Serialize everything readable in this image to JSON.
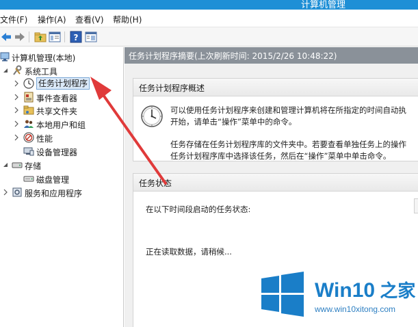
{
  "window": {
    "title": "计算机管理"
  },
  "menu": {
    "items": [
      {
        "label": "文件(F)"
      },
      {
        "label": "操作(A)"
      },
      {
        "label": "查看(V)"
      },
      {
        "label": "帮助(H)"
      }
    ]
  },
  "toolbar": {
    "buttons": [
      "back-arrow-icon",
      "forward-arrow-icon",
      "up-folder-icon",
      "show-hide-tree-icon",
      "help-icon",
      "properties-icon"
    ]
  },
  "tree": {
    "root": "计算机管理(本地)",
    "system_tools": "系统工具",
    "task_scheduler": "任务计划程序",
    "event_viewer": "事件查看器",
    "shared_folders": "共享文件夹",
    "local_users": "本地用户和组",
    "performance": "性能",
    "device_manager": "设备管理器",
    "storage": "存储",
    "disk_management": "磁盘管理",
    "services_apps": "服务和应用程序"
  },
  "pane": {
    "header": "任务计划程序摘要(上次刷新时间: 2015/2/26 10:48:22)",
    "overview": {
      "title": "任务计划程序概述",
      "line1": "可以使用任务计划程序来创建和管理计算机将在所指定的时间自动执",
      "line2": "开始，请单击“操作”菜单中的命令。",
      "line3": "任务存储在任务计划程序库的文件夹中。若要查看单独任务上的操作",
      "line4": "任务计划程序库中选择该任务，然后在“操作”菜单中单击命令。"
    },
    "status": {
      "title": "任务状态",
      "line1": "在以下时间段启动的任务状态:",
      "loading": "正在读取数据，请稍候..."
    }
  },
  "watermark": {
    "brand_prefix": "Win10",
    "brand_suffix": " 之家",
    "url": "www.win10xitong.com"
  },
  "colors": {
    "titlebar": "#1e8fd6",
    "pane_header": "#8a9199",
    "arrow": "#e03a3a",
    "brand": "#1a7ec8"
  }
}
